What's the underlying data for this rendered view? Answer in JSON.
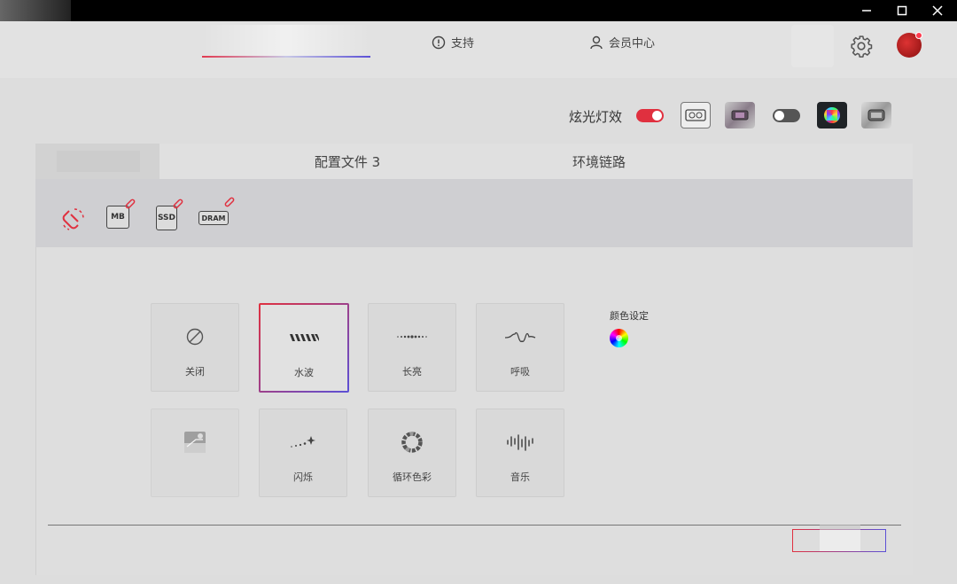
{
  "window": {
    "minimize_icon": "minimize-icon",
    "maximize_icon": "maximize-icon",
    "close_icon": "close-icon"
  },
  "header": {
    "support_label": "支持",
    "member_label": "会员中心",
    "accent_gradient": [
      "#e13a50",
      "#5b50d6"
    ]
  },
  "lighting": {
    "label": "炫光灯效",
    "main_toggle": "on",
    "secondary_toggle": "off",
    "accent_color": "#e0303f"
  },
  "tabs": [
    {
      "label": ""
    },
    {
      "label": "配置文件 3"
    },
    {
      "label": "环境链路"
    }
  ],
  "hardware": [
    {
      "label": ""
    },
    {
      "label": "MB"
    },
    {
      "label": "SSD"
    },
    {
      "label": "DRAM"
    }
  ],
  "modes": [
    {
      "label": "关闭",
      "icon": "off-icon"
    },
    {
      "label": "水波",
      "icon": "wave-icon",
      "selected": true
    },
    {
      "label": "长亮",
      "icon": "static-icon"
    },
    {
      "label": "呼吸",
      "icon": "breathing-icon"
    },
    {
      "label": "",
      "icon": "custom-icon"
    },
    {
      "label": "闪烁",
      "icon": "flash-icon"
    },
    {
      "label": "循环色彩",
      "icon": "color-cycle-icon"
    },
    {
      "label": "音乐",
      "icon": "music-icon"
    }
  ],
  "color_setting": {
    "label": "颜色设定"
  }
}
